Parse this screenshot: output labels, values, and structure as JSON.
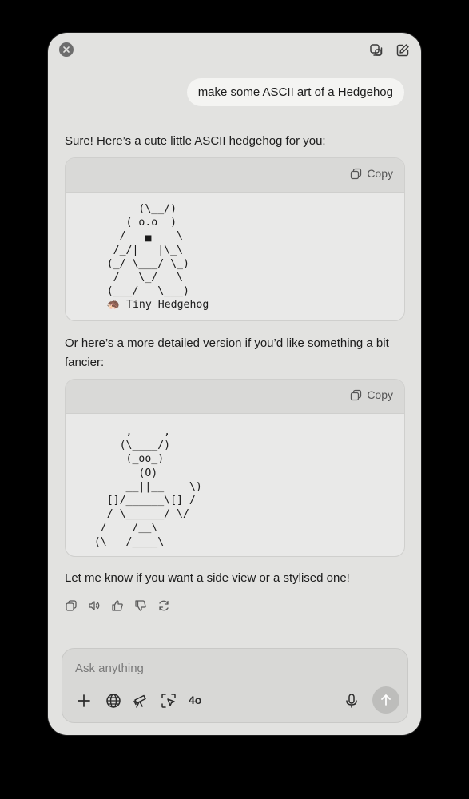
{
  "header": {
    "close_icon": "close-icon",
    "copy_chat_icon": "copy-window-icon",
    "new_chat_icon": "compose-icon"
  },
  "conversation": {
    "user_message": "make some ASCII art of a Hedgehog",
    "intro": "Sure! Here’s a cute little ASCII hedgehog for you:",
    "code_blocks": [
      {
        "copy_label": "Copy",
        "content": "          (\\__/)\n        ( o.o  )\n       /   ▄    \\\n      /_/|   |\\_\\\n     (_/ \\___/ \\_)\n      /   \\_/   \\\n     (___/   \\___)\n     🦔 Tiny Hedgehog"
      },
      {
        "copy_label": "Copy",
        "content": "        ,     ,\n       (\\____/)\n        (_oo_)\n          (O)\n        __||__    \\)\n     []/______\\[] /\n     / \\______/ \\/\n    /    /__\\\n   (\\   /____\\"
      }
    ],
    "middle_text": "Or here’s a more detailed version if you’d like something a bit fancier:",
    "closing_text": "Let me know if you want a side view or a stylised one!",
    "action_icons": [
      "copy-icon",
      "read-aloud-icon",
      "thumbs-up-icon",
      "thumbs-down-icon",
      "regenerate-icon"
    ]
  },
  "composer": {
    "placeholder": "Ask anything",
    "model": "4o",
    "tools": [
      "plus-icon",
      "globe-icon",
      "telescope-icon",
      "screen-select-icon"
    ],
    "mic_icon": "microphone-icon",
    "send_icon": "send-arrow-icon"
  },
  "colors": {
    "background": "#000000",
    "window": "#e2e2e0",
    "code_header": "#d9d9d7",
    "code_body": "#e9e9e8",
    "send_button": "#bdbdbb"
  }
}
